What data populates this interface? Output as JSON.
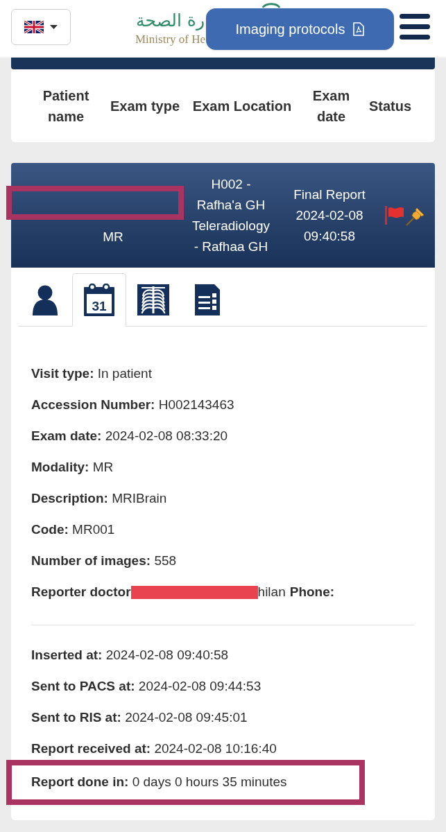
{
  "header": {
    "logo": {
      "arabic": "رة الصحة",
      "english": "Ministry of He"
    },
    "protocols_button": {
      "label": "Imaging protocols"
    }
  },
  "table_header": {
    "columns": [
      "Patient name",
      "Exam type",
      "Exam Location",
      "Exam date",
      "Status"
    ]
  },
  "study_card": {
    "name_highlighted": true,
    "exam_type": "MR",
    "location": "H002 - Rafha'a GH Teleradiology - Rafhaa GH",
    "status": "Final Report",
    "exam_date": "2024-02-08 09:40:58",
    "flagged": true,
    "pinned": true
  },
  "tabs": [
    {
      "kind": "patient",
      "selected": false
    },
    {
      "kind": "visit",
      "selected": true,
      "icon_text": "31"
    },
    {
      "kind": "images",
      "selected": false
    },
    {
      "kind": "report",
      "selected": false
    }
  ],
  "details": {
    "groups": [
      [
        {
          "kind": "field",
          "label": "Visit type:",
          "value": "In patient",
          "highlighted": false
        },
        {
          "kind": "field",
          "label": "Accession Number:",
          "value": "H002143463",
          "highlighted": false
        },
        {
          "kind": "field",
          "label": "Exam date:",
          "value": "2024-02-08 08:33:20",
          "highlighted": false
        },
        {
          "kind": "field",
          "label": "Modality:",
          "value": "MR",
          "highlighted": false
        },
        {
          "kind": "field",
          "label": "Description:",
          "value": "MRIBrain",
          "highlighted": false
        },
        {
          "kind": "field",
          "label": "Code:",
          "value": "MR001",
          "highlighted": false
        },
        {
          "kind": "field",
          "label": "Number of images:",
          "value": "558",
          "highlighted": false
        },
        {
          "kind": "redacted_field",
          "label": "Reporter doctor",
          "value": "hilan",
          "extra_label": "Phone:",
          "highlighted": false
        }
      ],
      [
        {
          "kind": "field",
          "label": "Inserted at:",
          "value": "2024-02-08 09:40:58",
          "highlighted": false
        },
        {
          "kind": "field",
          "label": "Sent to PACS at:",
          "value": "2024-02-08 09:44:53",
          "highlighted": false
        },
        {
          "kind": "field",
          "label": "Sent to RIS at:",
          "value": "2024-02-08 09:45:01",
          "highlighted": false
        },
        {
          "kind": "field",
          "label": "Report received at:",
          "value": "2024-02-08 10:16:40",
          "highlighted": false
        },
        {
          "kind": "field",
          "label": "Report done in:",
          "value": "0 days 0 hours 35 minutes",
          "highlighted": true
        }
      ]
    ]
  }
}
